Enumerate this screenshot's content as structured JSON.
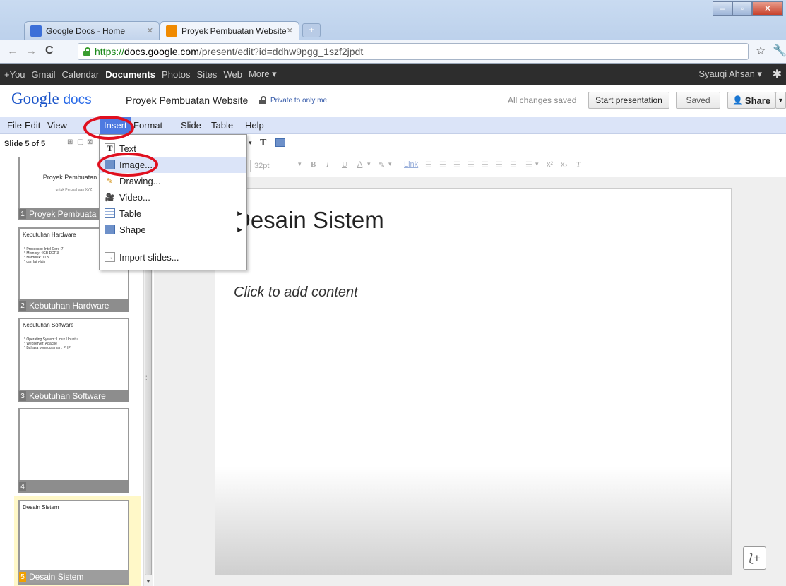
{
  "browser": {
    "tabs": [
      {
        "label": "Google Docs - Home",
        "active": false
      },
      {
        "label": "Proyek Pembuatan Website",
        "active": true
      }
    ],
    "url": {
      "scheme": "https://",
      "host": "docs.google.com",
      "path": "/present/edit?id=ddhw9pgg_1szf2jpdt"
    }
  },
  "gbar": {
    "links": [
      "+You",
      "Gmail",
      "Calendar",
      "Documents",
      "Photos",
      "Sites",
      "Web",
      "More ▾"
    ],
    "active": "Documents",
    "user": "Syauqi Ahsan ▾"
  },
  "header": {
    "logo_google": "Google",
    "logo_docs": "docs",
    "doc_title": "Proyek Pembuatan Website",
    "privacy": "Private to only me",
    "save_status": "All changes saved",
    "start_presentation": "Start presentation",
    "saved": "Saved",
    "share": "Share"
  },
  "menubar": {
    "items": [
      "File",
      "Edit",
      "View",
      "Insert",
      "Format",
      "Slide",
      "Table",
      "Help"
    ],
    "open": "Insert"
  },
  "insert_menu": {
    "items": [
      {
        "label": "Text",
        "icon": "text-box-icon",
        "submenu": false
      },
      {
        "label": "Image...",
        "icon": "image-icon",
        "submenu": false
      },
      {
        "label": "Drawing...",
        "icon": "drawing-icon",
        "submenu": false
      },
      {
        "label": "Video...",
        "icon": "video-icon",
        "submenu": false
      },
      {
        "label": "Table",
        "icon": "table-icon",
        "submenu": true
      },
      {
        "label": "Shape",
        "icon": "shape-icon",
        "submenu": true
      },
      {
        "label": "Import slides...",
        "icon": "import-icon",
        "submenu": false
      }
    ],
    "highlighted": "Image..."
  },
  "slide_panel": {
    "count": "Slide 5 of 5",
    "slides": [
      {
        "num": "1",
        "label": "Proyek Pembuata",
        "title": "Proyek Pembuatan W",
        "subtitle": "untuk Perusahaan XYZ"
      },
      {
        "num": "2",
        "label": "Kebutuhan Hardware",
        "title": "Kebutuhan Hardware",
        "bullets": "* Processor: Intel Core i7\n* Memory: 4GB DDR3\n* Harddisk: 1TB\n* dan lain-lain"
      },
      {
        "num": "3",
        "label": "Kebutuhan Software",
        "title": "Kebutuhan Software",
        "bullets": "* Operating System: Linux Ubuntu\n* Webserver: Apache\n* Bahasa pemrograman: PHP"
      },
      {
        "num": "4",
        "label": "",
        "title": ""
      },
      {
        "num": "5",
        "label": "Desain Sistem",
        "title": "Desain Sistem"
      }
    ],
    "selected": "5"
  },
  "toolbar": {
    "font_size": "32pt",
    "link": "Link"
  },
  "slide": {
    "title": "Desain Sistem",
    "body_placeholder": "Click to add content"
  }
}
